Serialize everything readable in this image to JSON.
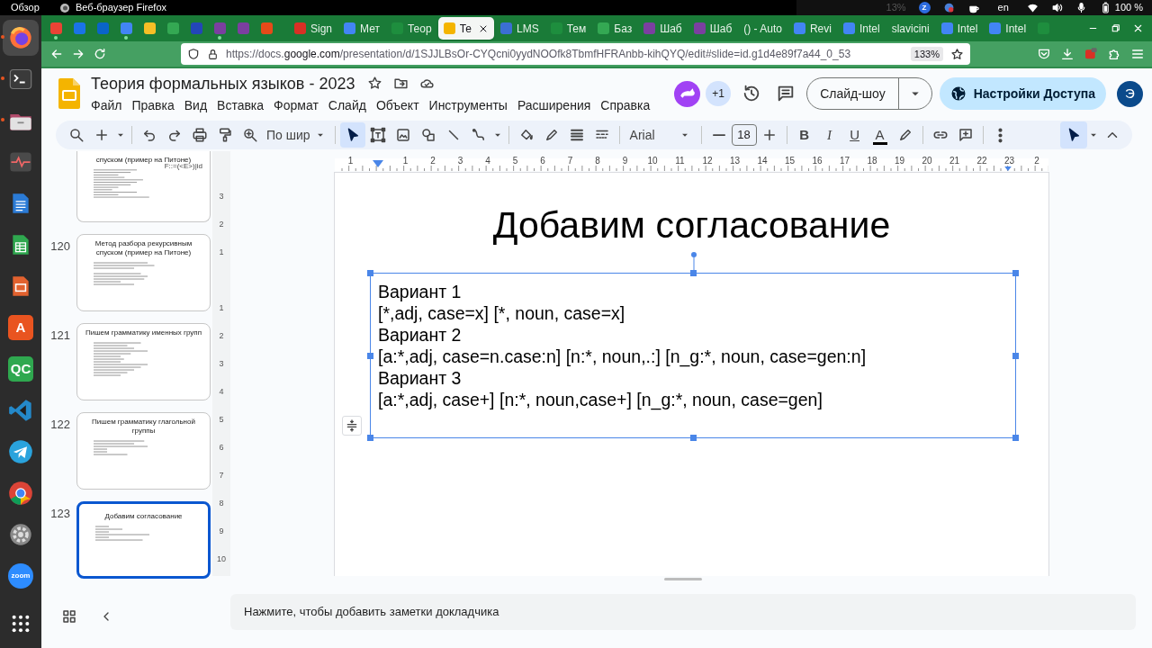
{
  "system_bar": {
    "activities": "Обзор",
    "app": "Веб-браузер Firefox",
    "cpu": "13%",
    "tray_letter": "Z",
    "keyboard": "en",
    "battery": "100 %"
  },
  "dock": [
    {
      "kind": "firefox",
      "running": true,
      "selected": true
    },
    {
      "kind": "terminal",
      "running": true,
      "selected": false
    },
    {
      "kind": "files",
      "running": true,
      "selected": false
    },
    {
      "kind": "monitor",
      "running": false,
      "selected": false
    },
    {
      "kind": "writer",
      "running": false,
      "selected": false
    },
    {
      "kind": "calc",
      "running": false,
      "selected": false
    },
    {
      "kind": "impress",
      "running": false,
      "selected": false
    },
    {
      "kind": "letter",
      "label": "A",
      "color": "#e95420",
      "running": false,
      "selected": false
    },
    {
      "kind": "letter",
      "label": "QC",
      "color": "#2fa84f",
      "running": false,
      "selected": false
    },
    {
      "kind": "vscode",
      "running": false,
      "selected": false
    },
    {
      "kind": "telegram",
      "running": false,
      "selected": false
    },
    {
      "kind": "chrome",
      "running": false,
      "selected": false
    },
    {
      "kind": "settings",
      "running": false,
      "selected": false
    },
    {
      "kind": "zoom",
      "label": "zoom",
      "running": false,
      "selected": false
    },
    {
      "kind": "apps",
      "running": false,
      "selected": false
    }
  ],
  "browser": {
    "pinned_tabs": [
      {
        "color": "#ea4335",
        "attention": true
      },
      {
        "color": "#1a73e8",
        "attention": false
      },
      {
        "color": "#0a64c8",
        "attention": false
      },
      {
        "color": "#4285f4",
        "attention": true
      },
      {
        "color": "#f6bf26",
        "attention": false
      },
      {
        "color": "#34a853",
        "attention": false
      },
      {
        "color": "#2346b8",
        "attention": false
      },
      {
        "color": "#7b3fa0",
        "attention": true
      },
      {
        "color": "#7b3fa0",
        "attention": false
      },
      {
        "color": "#e64a19",
        "attention": false
      }
    ],
    "tabs": [
      {
        "label": "Sign",
        "color": "#d93025",
        "selected": false
      },
      {
        "label": "Мет",
        "color": "#4285f4",
        "selected": false
      },
      {
        "label": "Теор",
        "color": "#1e8e3e",
        "selected": false
      },
      {
        "label": "Те",
        "color": "#f4b400",
        "selected": true
      },
      {
        "label": "LMS",
        "color": "#3b6fd4",
        "selected": false
      },
      {
        "label": "Тем",
        "color": "#1e8e3e",
        "selected": false
      },
      {
        "label": "Баз",
        "color": "#34a853",
        "selected": false
      },
      {
        "label": "Шаб",
        "color": "#7b3fa0",
        "selected": false
      },
      {
        "label": "Шаб",
        "color": "#7b3fa0",
        "selected": false
      },
      {
        "label": "() - Auto",
        "selected": false
      },
      {
        "label": "Revi",
        "color": "#4285f4",
        "selected": false
      },
      {
        "label": "Intel",
        "color": "#4285f4",
        "selected": false
      },
      {
        "label": "slavicini",
        "selected": false
      },
      {
        "label": "Intel",
        "color": "#4285f4",
        "selected": false
      },
      {
        "label": "Intel",
        "color": "#4285f4",
        "selected": false
      },
      {
        "color": "#1e8e3e",
        "selected": false
      }
    ],
    "url": "https://docs.**google.com**/presentation/d/1SJJLBsOr-CYQcni0yydNOOfk8TbmfHFRAnbb-kihQYQ/edit#slide=id.g1d4e89f7a44_0_53",
    "zoom": "133%"
  },
  "docs": {
    "title": "Теория формальных языков - 2023",
    "menu": [
      "Файл",
      "Правка",
      "Вид",
      "Вставка",
      "Формат",
      "Слайд",
      "Объект",
      "Инструменты",
      "Расширения",
      "Справка"
    ],
    "collaborators_more": "+1",
    "slideshow": "Слайд-шоу",
    "share": "Настройки Доступа",
    "account": "Э"
  },
  "toolbar": {
    "zoom": "По шир",
    "tools": [
      {
        "kind": "select",
        "selected": true
      },
      {
        "kind": "textbox",
        "selected": false
      },
      {
        "kind": "image",
        "selected": false
      },
      {
        "kind": "shape",
        "selected": false
      },
      {
        "kind": "line",
        "selected": false
      },
      {
        "kind": "connector",
        "selected": false
      }
    ],
    "font": "Arial",
    "font_size": "18",
    "format": [
      {
        "kind": "bold",
        "label": "B"
      },
      {
        "kind": "italic",
        "label": "I"
      },
      {
        "kind": "underline",
        "label": "U"
      },
      {
        "kind": "color",
        "label": "A"
      }
    ],
    "mode_selected": true
  },
  "filmstrip": [
    {
      "title": "спуском (пример на Питоне)",
      "side_text": "F::=(<E>)|id",
      "selected": false
    },
    {
      "number": "120",
      "title": "Метод разбора рекурсивным спуском (пример на Питоне)",
      "selected": false
    },
    {
      "number": "121",
      "title": "Пишем грамматику именных групп",
      "selected": false
    },
    {
      "number": "122",
      "title": "Пишем грамматику глагольной группы",
      "selected": false
    },
    {
      "number": "123",
      "title": "Добавим согласование",
      "selected": true
    }
  ],
  "ruler": {
    "labels": [
      "1",
      "1",
      "2",
      "3",
      "4",
      "5",
      "6",
      "7",
      "8",
      "9",
      "10",
      "11",
      "12",
      "13",
      "14",
      "15",
      "16",
      "17",
      "18",
      "19",
      "20",
      "21",
      "22",
      "23",
      "2"
    ]
  },
  "vertical_ruler": {
    "labels": [
      "3",
      "2",
      "1",
      "1",
      "2",
      "3",
      "4",
      "5",
      "6",
      "7",
      "8",
      "9",
      "10"
    ]
  },
  "slide": {
    "title": "Добавим согласование",
    "body": [
      "Вариант 1",
      "[*,adj, case=x] [*, noun, case=x]",
      "Вариант 2",
      "[a:*,adj, case=n.case:n] [n:*, noun,.:] [n_g:*, noun, case=gen:n]",
      "Вариант 3",
      "[a:*,adj, case+] [n:*, noun,case+] [n_g:*, noun, case=gen]"
    ],
    "body_selected": true
  },
  "notes": {
    "placeholder": "Нажмите, чтобы добавить заметки докладчика"
  }
}
